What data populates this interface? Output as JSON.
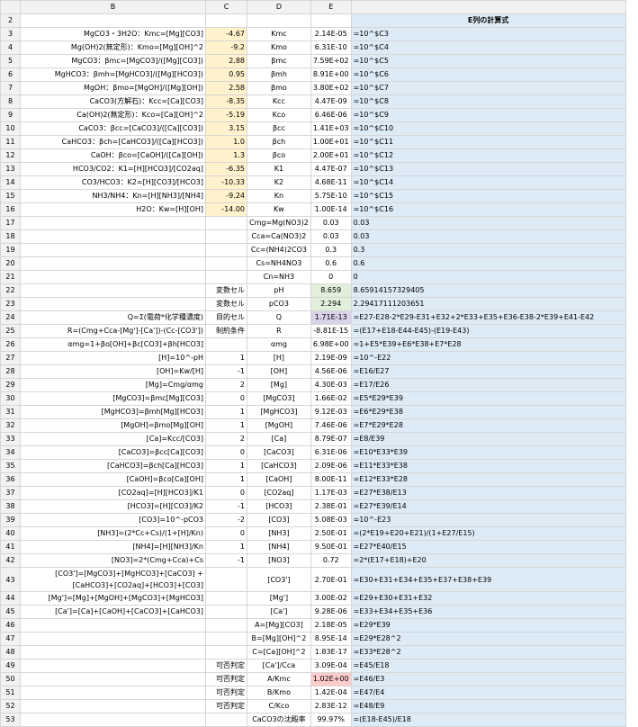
{
  "columns": [
    "B",
    "C",
    "D",
    "E"
  ],
  "formula_header": "E列の計算式",
  "rows": [
    {
      "n": "2",
      "b": "",
      "c": "",
      "d": "",
      "e": "",
      "f": ""
    },
    {
      "n": "3",
      "b": "MgCO3・3H2O：Kmc=[Mg][CO3]",
      "c": "-4.67",
      "d": "Kmc",
      "e": "2.14E-05",
      "f": "=10^$C3"
    },
    {
      "n": "4",
      "b": "Mg(OH)2(無定形)：Kmo=[Mg][OH]^2",
      "c": "-9.2",
      "d": "Kmo",
      "e": "6.31E-10",
      "f": "=10^$C4"
    },
    {
      "n": "5",
      "b": "MgCO3：βmc=[MgCO3]/([Mg][CO3])",
      "c": "2.88",
      "d": "βmc",
      "e": "7.59E+02",
      "f": "=10^$C5"
    },
    {
      "n": "6",
      "b": "MgHCO3：βmh=[MgHCO3]/([Mg][HCO3])",
      "c": "0.95",
      "d": "βmh",
      "e": "8.91E+00",
      "f": "=10^$C6"
    },
    {
      "n": "7",
      "b": "MgOH：βmo=[MgOH]/([Mg][OH])",
      "c": "2.58",
      "d": "βmo",
      "e": "3.80E+02",
      "f": "=10^$C7"
    },
    {
      "n": "8",
      "b": "CaCO3(方解石)：Kcc=[Ca][CO3]",
      "c": "-8.35",
      "d": "Kcc",
      "e": "4.47E-09",
      "f": "=10^$C8"
    },
    {
      "n": "9",
      "b": "Ca(OH)2(無定形)：Kco=[Ca][OH]^2",
      "c": "-5.19",
      "d": "Kco",
      "e": "6.46E-06",
      "f": "=10^$C9"
    },
    {
      "n": "10",
      "b": "CaCO3：βcc=[CaCO3]/([Ca][CO3])",
      "c": "3.15",
      "d": "βcc",
      "e": "1.41E+03",
      "f": "=10^$C10"
    },
    {
      "n": "11",
      "b": "CaHCO3：βch=[CaHCO3]/([Ca][HCO3])",
      "c": "1.0",
      "d": "βch",
      "e": "1.00E+01",
      "f": "=10^$C11"
    },
    {
      "n": "12",
      "b": "CaOH：βco=[CaOH]/([Ca][OH])",
      "c": "1.3",
      "d": "βco",
      "e": "2.00E+01",
      "f": "=10^$C12"
    },
    {
      "n": "13",
      "b": "HCO3/CO2：K1=[H][HCO3]/[CO2aq]",
      "c": "-6.35",
      "d": "K1",
      "e": "4.47E-07",
      "f": "=10^$C13"
    },
    {
      "n": "14",
      "b": "CO3/HCO3：K2=[H][CO3]/[HCO3]",
      "c": "-10.33",
      "d": "K2",
      "e": "4.68E-11",
      "f": "=10^$C14"
    },
    {
      "n": "15",
      "b": "NH3/NH4：Kn=[H][NH3]/[NH4]",
      "c": "-9.24",
      "d": "Kn",
      "e": "5.75E-10",
      "f": "=10^$C15"
    },
    {
      "n": "16",
      "b": "H2O：Kw=[H][OH]",
      "c": "-14.00",
      "d": "Kw",
      "e": "1.00E-14",
      "f": "=10^$C16"
    },
    {
      "n": "17",
      "b": "",
      "c": "",
      "d": "Cmg=Mg(NO3)2",
      "e": "0.03",
      "f": "0.03"
    },
    {
      "n": "18",
      "b": "",
      "c": "",
      "d": "Cca=Ca(NO3)2",
      "e": "0.03",
      "f": "0.03"
    },
    {
      "n": "19",
      "b": "",
      "c": "",
      "d": "Cc=(NH4)2CO3",
      "e": "0.3",
      "f": "0.3"
    },
    {
      "n": "20",
      "b": "",
      "c": "",
      "d": "Cs=NH4NO3",
      "e": "0.6",
      "f": "0.6"
    },
    {
      "n": "21",
      "b": "",
      "c": "",
      "d": "Cn=NH3",
      "e": "0",
      "f": "0"
    },
    {
      "n": "22",
      "b": "",
      "c": "変数セル",
      "d": "pH",
      "e": "8.659",
      "f": "8.65914157329405"
    },
    {
      "n": "23",
      "b": "",
      "c": "変数セル",
      "d": "pCO3",
      "e": "2.294",
      "f": "2.29417111203651"
    },
    {
      "n": "24",
      "b": "Q=Σ(電荷*化学種濃度)",
      "c": "目的セル",
      "d": "Q",
      "e": "1.71E-13",
      "f": "=E27-E28-2*E29-E31+E32+2*E33+E35+E36-E38-2*E39+E41-E42"
    },
    {
      "n": "25",
      "b": "R=(Cmg+Cca-[Mg']-[Ca'])-(Cc-[CO3'])",
      "c": "制約条件",
      "d": "R",
      "e": "-8.81E-15",
      "f": "=(E17+E18-E44-E45)-(E19-E43)"
    },
    {
      "n": "26",
      "b": "αmg=1+βo[OH]+βc[CO3]+βh[HCO3]",
      "c": "",
      "d": "αmg",
      "e": "6.98E+00",
      "f": "=1+E5*E39+E6*E38+E7*E28"
    },
    {
      "n": "27",
      "b": "[H]=10^-pH",
      "c": "1",
      "d": "[H]",
      "e": "2.19E-09",
      "f": "=10^-E22"
    },
    {
      "n": "28",
      "b": "[OH]=Kw/[H]",
      "c": "-1",
      "d": "[OH]",
      "e": "4.56E-06",
      "f": "=E16/E27"
    },
    {
      "n": "29",
      "b": "[Mg]=Cmg/αmg",
      "c": "2",
      "d": "[Mg]",
      "e": "4.30E-03",
      "f": "=E17/E26"
    },
    {
      "n": "30",
      "b": "[MgCO3]=βmc[Mg][CO3]",
      "c": "0",
      "d": "[MgCO3]",
      "e": "1.66E-02",
      "f": "=E5*E29*E39"
    },
    {
      "n": "31",
      "b": "[MgHCO3]=βmh[Mg][HCO3]",
      "c": "1",
      "d": "[MgHCO3]",
      "e": "9.12E-03",
      "f": "=E6*E29*E38"
    },
    {
      "n": "32",
      "b": "[MgOH]=βmo[Mg][OH]",
      "c": "1",
      "d": "[MgOH]",
      "e": "7.46E-06",
      "f": "=E7*E29*E28"
    },
    {
      "n": "33",
      "b": "[Ca]=Kcc/[CO3]",
      "c": "2",
      "d": "[Ca]",
      "e": "8.79E-07",
      "f": "=E8/E39"
    },
    {
      "n": "34",
      "b": "[CaCO3]=βcc[Ca][CO3]",
      "c": "0",
      "d": "[CaCO3]",
      "e": "6.31E-06",
      "f": "=E10*E33*E39"
    },
    {
      "n": "35",
      "b": "[CaHCO3]=βch[Ca][HCO3]",
      "c": "1",
      "d": "[CaHCO3]",
      "e": "2.09E-06",
      "f": "=E11*E33*E38"
    },
    {
      "n": "36",
      "b": "[CaOH]=βco[Ca][OH]",
      "c": "1",
      "d": "[CaOH]",
      "e": "8.00E-11",
      "f": "=E12*E33*E28"
    },
    {
      "n": "37",
      "b": "[CO2aq]=[H][HCO3]/K1",
      "c": "0",
      "d": "[CO2aq]",
      "e": "1.17E-03",
      "f": "=E27*E38/E13"
    },
    {
      "n": "38",
      "b": "[HCO3]=[H][CO3]/K2",
      "c": "-1",
      "d": "[HCO3]",
      "e": "2.38E-01",
      "f": "=E27*E39/E14"
    },
    {
      "n": "39",
      "b": "[CO3]=10^-pCO3",
      "c": "-2",
      "d": "[CO3]",
      "e": "5.08E-03",
      "f": "=10^-E23"
    },
    {
      "n": "40",
      "b": "[NH3]=(2*Cc+Cs)/(1+[H]/Kn)",
      "c": "0",
      "d": "[NH3]",
      "e": "2.50E-01",
      "f": "=(2*E19+E20+E21)/(1+E27/E15)"
    },
    {
      "n": "41",
      "b": "[NH4]=[H][NH3]/Kn",
      "c": "1",
      "d": "[NH4]",
      "e": "9.50E-01",
      "f": "=E27*E40/E15"
    },
    {
      "n": "42",
      "b": "[NO3]=2*(Cmg+Cca)+Cs",
      "c": "-1",
      "d": "[NO3]",
      "e": "0.72",
      "f": "=2*(E17+E18)+E20"
    },
    {
      "n": "43",
      "b": "[CO3']=[MgCO3]+[MgHCO3]+[CaCO3] +[CaHCO3]+[CO2aq]+[HCO3]+[CO3]",
      "c": "",
      "d": "[CO3']",
      "e": "2.70E-01",
      "f": "=E30+E31+E34+E35+E37+E38+E39"
    },
    {
      "n": "44",
      "b": "[Mg']=[Mg]+[MgOH]+[MgCO3]+[MgHCO3]",
      "c": "",
      "d": "[Mg']",
      "e": "3.00E-02",
      "f": "=E29+E30+E31+E32"
    },
    {
      "n": "45",
      "b": "[Ca']=[Ca]+[CaOH]+[CaCO3]+[CaHCO3]",
      "c": "",
      "d": "[Ca']",
      "e": "9.28E-06",
      "f": "=E33+E34+E35+E36"
    },
    {
      "n": "46",
      "b": "",
      "c": "",
      "d": "A=[Mg][CO3]",
      "e": "2.18E-05",
      "f": "=E29*E39"
    },
    {
      "n": "47",
      "b": "",
      "c": "",
      "d": "B=[Mg][OH]^2",
      "e": "8.95E-14",
      "f": "=E29*E28^2"
    },
    {
      "n": "48",
      "b": "",
      "c": "",
      "d": "C=[Ca][OH]^2",
      "e": "1.83E-17",
      "f": "=E33*E28^2"
    },
    {
      "n": "49",
      "b": "",
      "c": "可否判定",
      "d": "[Ca']/Cca",
      "e": "3.09E-04",
      "f": "=E45/E18"
    },
    {
      "n": "50",
      "b": "",
      "c": "可否判定",
      "d": "A/Kmc",
      "e": "1.02E+00",
      "f": "=E46/E3"
    },
    {
      "n": "51",
      "b": "",
      "c": "可否判定",
      "d": "B/Kmo",
      "e": "1.42E-04",
      "f": "=E47/E4"
    },
    {
      "n": "52",
      "b": "",
      "c": "可否判定",
      "d": "C/Kco",
      "e": "2.83E-12",
      "f": "=E48/E9"
    },
    {
      "n": "53",
      "b": "",
      "c": "",
      "d": "CaCO3の沈殿率",
      "e": "99.97%",
      "f": "=(E18-E45)/E18"
    }
  ],
  "colors": {
    "formula_bg": "#ddebf7",
    "formula_text": "#ff0000",
    "yellow": "#fff2cc",
    "green": "#e2efda",
    "purple": "#d9d2e9",
    "pink": "#ffcccc"
  }
}
